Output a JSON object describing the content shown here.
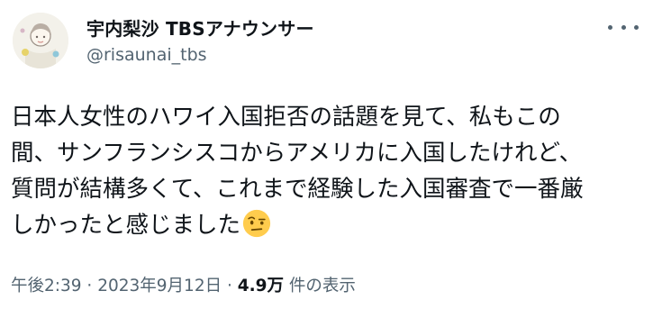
{
  "user": {
    "display_name": "宇内梨沙 TBSアナウンサー",
    "handle": "@risaunai_tbs",
    "avatar": "avatar-illustration"
  },
  "tweet": {
    "lines": [
      "日本人女性のハワイ入国拒否の話題を見て、私もこの",
      "間、サンフランシスコからアメリカに入国したけれど、",
      "質問が結構多くて、これまで経験した入国審査で一番厳",
      "しかったと感じました"
    ],
    "emoji": "face-with-raised-eyebrow-emoji"
  },
  "meta": {
    "time": "午後2:39",
    "separator1": " · ",
    "date": "2023年9月12日",
    "separator2": " · ",
    "views_count": "4.9万",
    "views_label": " 件の表示"
  },
  "icons": {
    "more": "more-options-icon"
  },
  "colors": {
    "text_primary": "#0f1419",
    "text_secondary": "#536471",
    "background": "#ffffff"
  }
}
